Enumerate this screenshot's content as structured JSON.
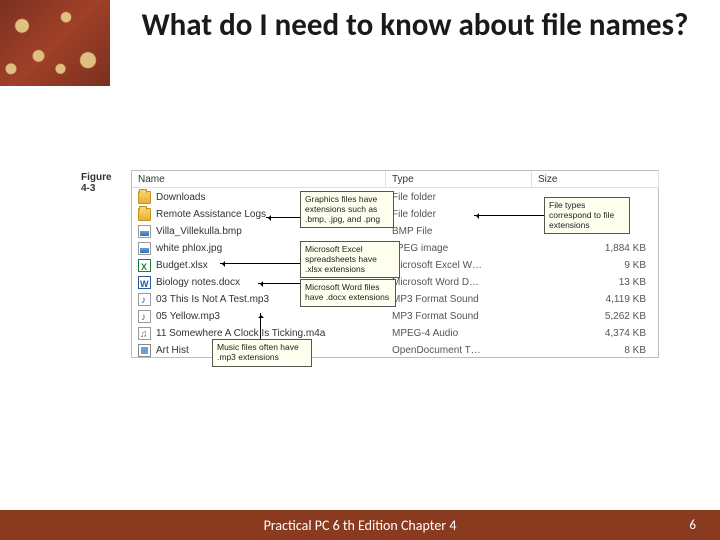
{
  "title": "What do I need to know about file names?",
  "figure": {
    "label": "Figure\n4-3",
    "columns": {
      "name": "Name",
      "type": "Type",
      "size": "Size"
    },
    "rows": [
      {
        "icon": "folder",
        "name": "Downloads",
        "type": "File folder",
        "size": ""
      },
      {
        "icon": "folder",
        "name": "Remote Assistance Logs",
        "type": "File folder",
        "size": ""
      },
      {
        "icon": "bmp",
        "name": "Villa_Villekulla.bmp",
        "type": "BMP File",
        "size": ""
      },
      {
        "icon": "jpg",
        "name": "white phlox.jpg",
        "type": "JPEG image",
        "size": "1,884 KB"
      },
      {
        "icon": "xlsx",
        "name": "Budget.xlsx",
        "type": "Microsoft Excel W…",
        "size": "9 KB"
      },
      {
        "icon": "docx",
        "name": "Biology notes.docx",
        "type": "Microsoft Word D…",
        "size": "13 KB"
      },
      {
        "icon": "mp3",
        "name": "03 This Is Not A Test.mp3",
        "type": "MP3 Format Sound",
        "size": "4,119 KB"
      },
      {
        "icon": "mp3",
        "name": "05 Yellow.mp3",
        "type": "MP3 Format Sound",
        "size": "5,262 KB"
      },
      {
        "icon": "m4a",
        "name": "11 Somewhere A Clock Is Ticking.m4a",
        "type": "MPEG-4 Audio",
        "size": "4,374 KB"
      },
      {
        "icon": "odt",
        "name": "Art Hist",
        "type": "OpenDocument T…",
        "size": "8 KB"
      }
    ],
    "callouts": {
      "graphics": "Graphics files have extensions such as .bmp, .jpg, and .png",
      "excel": "Microsoft Excel spreadsheets have .xlsx extensions",
      "word": "Microsoft Word files have .docx extensions",
      "music": "Music files often have .mp3 extensions",
      "types": "File types correspond to file extensions"
    }
  },
  "footer": {
    "title": "Practical PC 6 th Edition Chapter 4",
    "page": "6"
  }
}
